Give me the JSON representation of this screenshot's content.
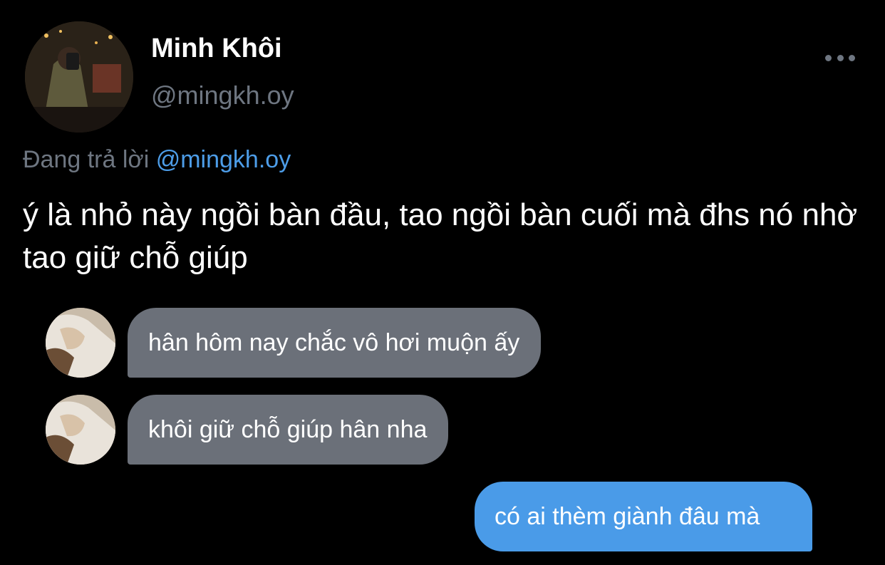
{
  "author": {
    "display_name": "Minh Khôi",
    "handle": "@mingkh.oy",
    "avatar_icon": "profile-photo"
  },
  "more_icon": "more-horizontal-icon",
  "reply": {
    "prefix": "Đang trả lời",
    "mention": "@mingkh.oy"
  },
  "tweet": {
    "text": "ý là nhỏ này ngồi bàn đầu, tao ngồi bàn cuối mà đhs nó nhờ tao giữ chỗ giúp"
  },
  "chat": {
    "messages": [
      {
        "direction": "incoming",
        "text": "hân hôm nay chắc vô hơi muộn ấy"
      },
      {
        "direction": "incoming",
        "text": "khôi giữ chỗ giúp hân nha"
      },
      {
        "direction": "outgoing",
        "text": "có ai thèm giành đâu mà"
      }
    ]
  },
  "colors": {
    "background": "#000000",
    "secondary_text": "#6e7681",
    "mention": "#4d9de8",
    "incoming_bubble": "#6b7079",
    "outgoing_bubble": "#4a9be8"
  }
}
